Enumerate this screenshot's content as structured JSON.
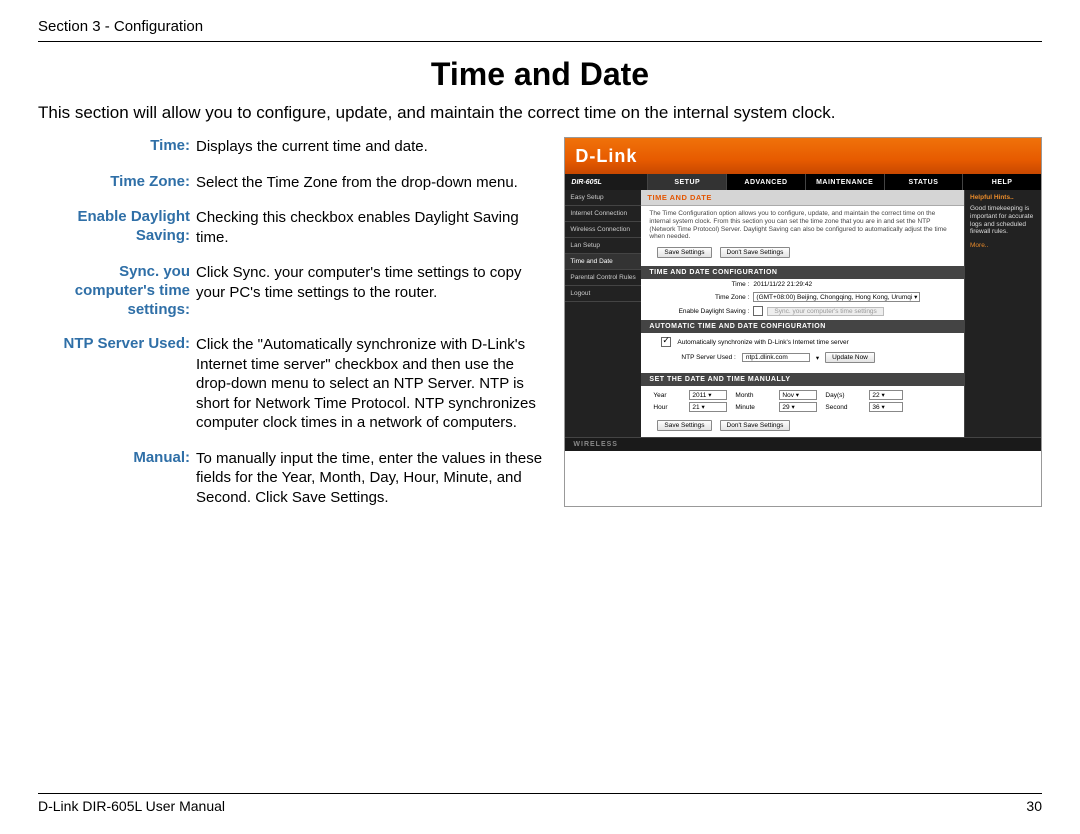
{
  "header": {
    "section": "Section 3 - Configuration"
  },
  "title": "Time and Date",
  "intro": "This section will allow you to configure, update, and maintain the correct time on the internal system clock.",
  "defs": [
    {
      "label": "Time:",
      "text": "Displays the current time and date."
    },
    {
      "label": "Time Zone:",
      "text": "Select the Time Zone from the drop-down menu."
    },
    {
      "label": "Enable Daylight Saving:",
      "text": "Checking this checkbox enables Daylight Saving time."
    },
    {
      "label": "Sync. you computer's time settings:",
      "text": "Click Sync. your computer's time settings to copy your PC's time settings to the router."
    },
    {
      "label": "NTP Server Used:",
      "text": "Click the \"Automatically synchronize with D-Link's Internet time server\" checkbox and then use the drop-down menu to select an NTP Server. NTP is short for Network Time Protocol. NTP synchronizes computer clock times in a network of computers."
    },
    {
      "label": "Manual:",
      "text": "To manually input the time, enter the values in these fields for the Year, Month, Day, Hour, Minute, and Second. Click Save Settings."
    }
  ],
  "screenshot": {
    "brand": "D-Link",
    "model": "DIR-605L",
    "tabs": [
      "SETUP",
      "ADVANCED",
      "MAINTENANCE",
      "STATUS",
      "HELP"
    ],
    "active_tab": 0,
    "sidenav": [
      "Easy Setup",
      "Internet Connection",
      "Wireless Connection",
      "Lan Setup",
      "Time and Date",
      "Parental Control Rules",
      "Logout"
    ],
    "sidenav_active": 4,
    "panel_title": "TIME AND DATE",
    "panel_para": "The Time Configuration option allows you to configure, update, and maintain the correct time on the internal system clock. From this section you can set the time zone that you are in and set the NTP (Network Time Protocol) Server. Daylight Saving can also be configured to automatically adjust the time when needed.",
    "btn_save": "Save Settings",
    "btn_dont": "Don't Save Settings",
    "sub_conf": "TIME AND DATE CONFIGURATION",
    "time_label": "Time  :",
    "time_value": "2011/11/22 21:29:42",
    "tz_label": "Time Zone  :",
    "tz_value": "(GMT+08:00) Beijing, Chongqing, Hong Kong, Urumqi",
    "dst_label": "Enable Daylight Saving  :",
    "sync_btn": "Sync. your computer's time settings",
    "sub_auto": "AUTOMATIC TIME AND DATE CONFIGURATION",
    "auto_text": "Automatically synchronize with D-Link's Internet time server",
    "ntp_label": "NTP Server Used :",
    "ntp_value": "ntp1.dlink.com",
    "update_btn": "Update Now",
    "sub_manual": "SET THE DATE AND TIME MANUALLY",
    "manual": {
      "year_l": "Year",
      "year_v": "2011",
      "month_l": "Month",
      "month_v": "Nov",
      "day_l": "Day(s)",
      "day_v": "22",
      "hour_l": "Hour",
      "hour_v": "21",
      "min_l": "Minute",
      "min_v": "29",
      "sec_l": "Second",
      "sec_v": "36"
    },
    "right": {
      "hdr": "Helpful Hints..",
      "txt": "Good timekeeping is important for accurate logs and scheduled firewall rules.",
      "more": "More.."
    },
    "wireless": "WIRELESS"
  },
  "footer": {
    "left": "D-Link DIR-605L User Manual",
    "right": "30"
  }
}
